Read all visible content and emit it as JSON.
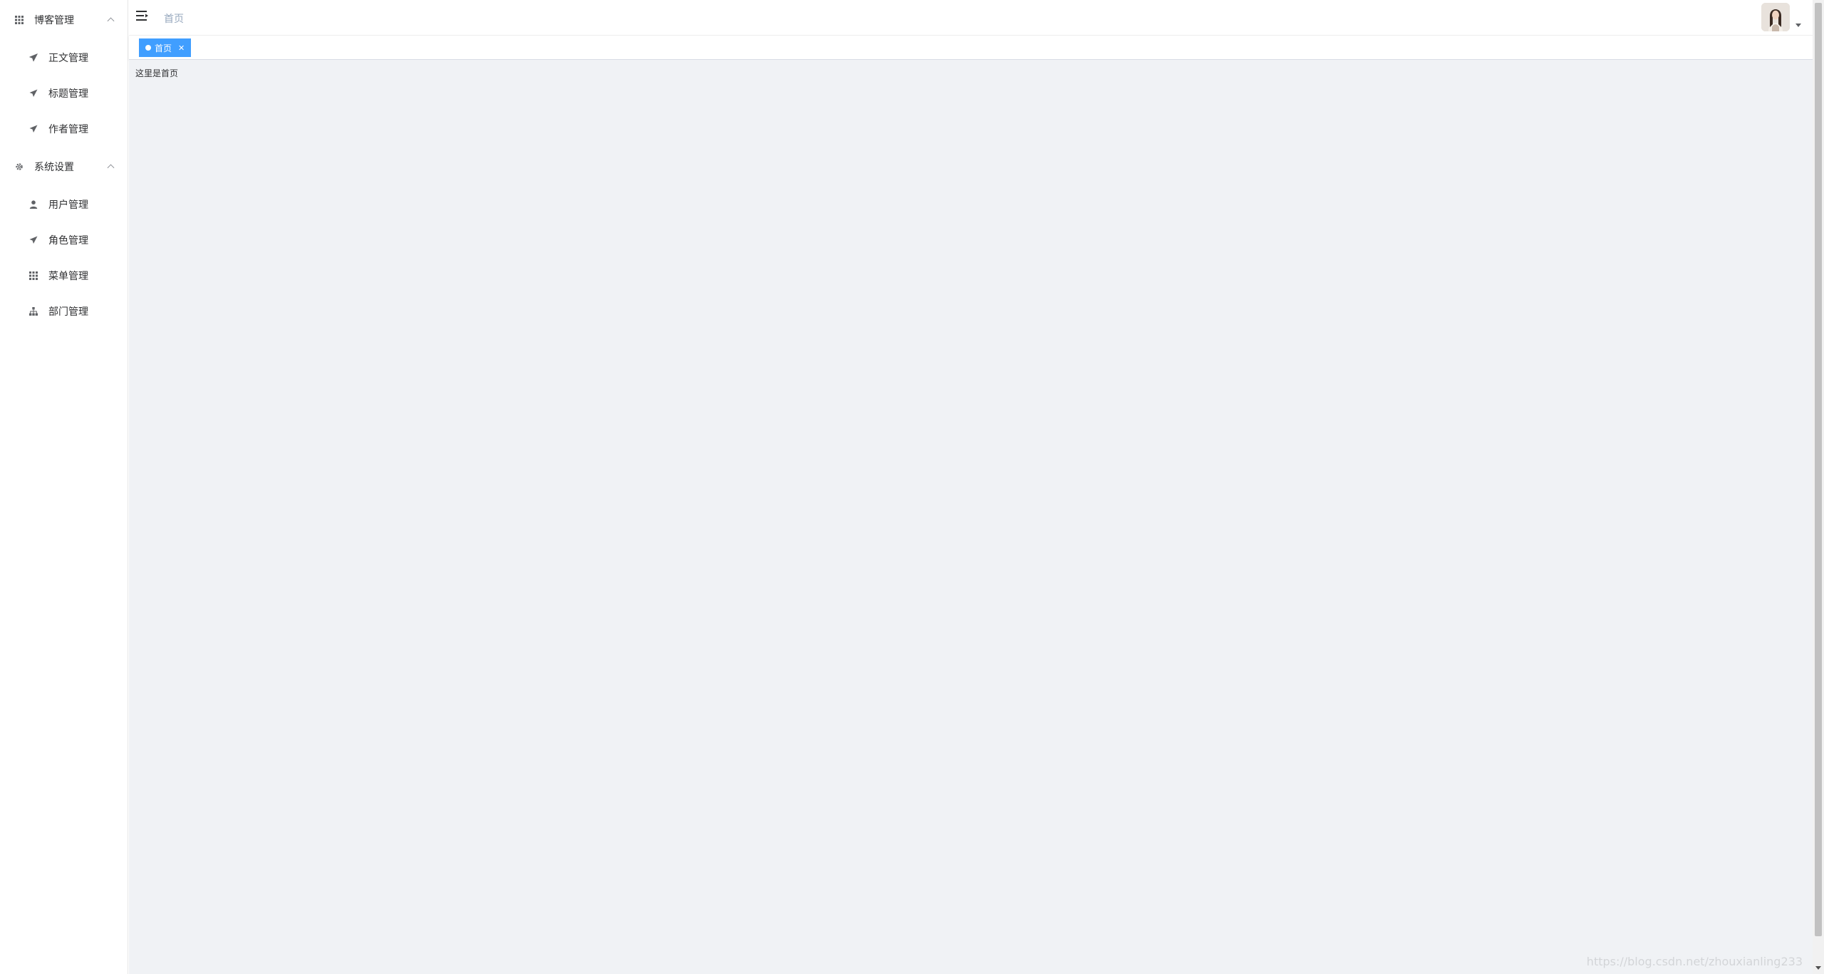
{
  "sidebar": {
    "groups": [
      {
        "title": "博客管理",
        "icon": "grid-icon",
        "items": [
          {
            "label": "正文管理",
            "icon": "paper-plane-icon"
          },
          {
            "label": "标题管理",
            "icon": "paper-plane-icon"
          },
          {
            "label": "作者管理",
            "icon": "paper-plane-icon"
          }
        ]
      },
      {
        "title": "系统设置",
        "icon": "gear-icon",
        "items": [
          {
            "label": "用户管理",
            "icon": "user-icon"
          },
          {
            "label": "角色管理",
            "icon": "paper-plane-icon"
          },
          {
            "label": "菜单管理",
            "icon": "grid-icon"
          },
          {
            "label": "部门管理",
            "icon": "org-chart-icon"
          }
        ]
      }
    ]
  },
  "header": {
    "breadcrumb": "首页"
  },
  "tags": [
    {
      "label": "首页",
      "active": true
    }
  ],
  "main": {
    "text": "这里是首页",
    "watermark": "https://blog.csdn.net/zhouxianling233"
  },
  "colors": {
    "accent": "#409eff",
    "content_bg": "#f0f2f5",
    "breadcrumb": "#97a8be"
  }
}
